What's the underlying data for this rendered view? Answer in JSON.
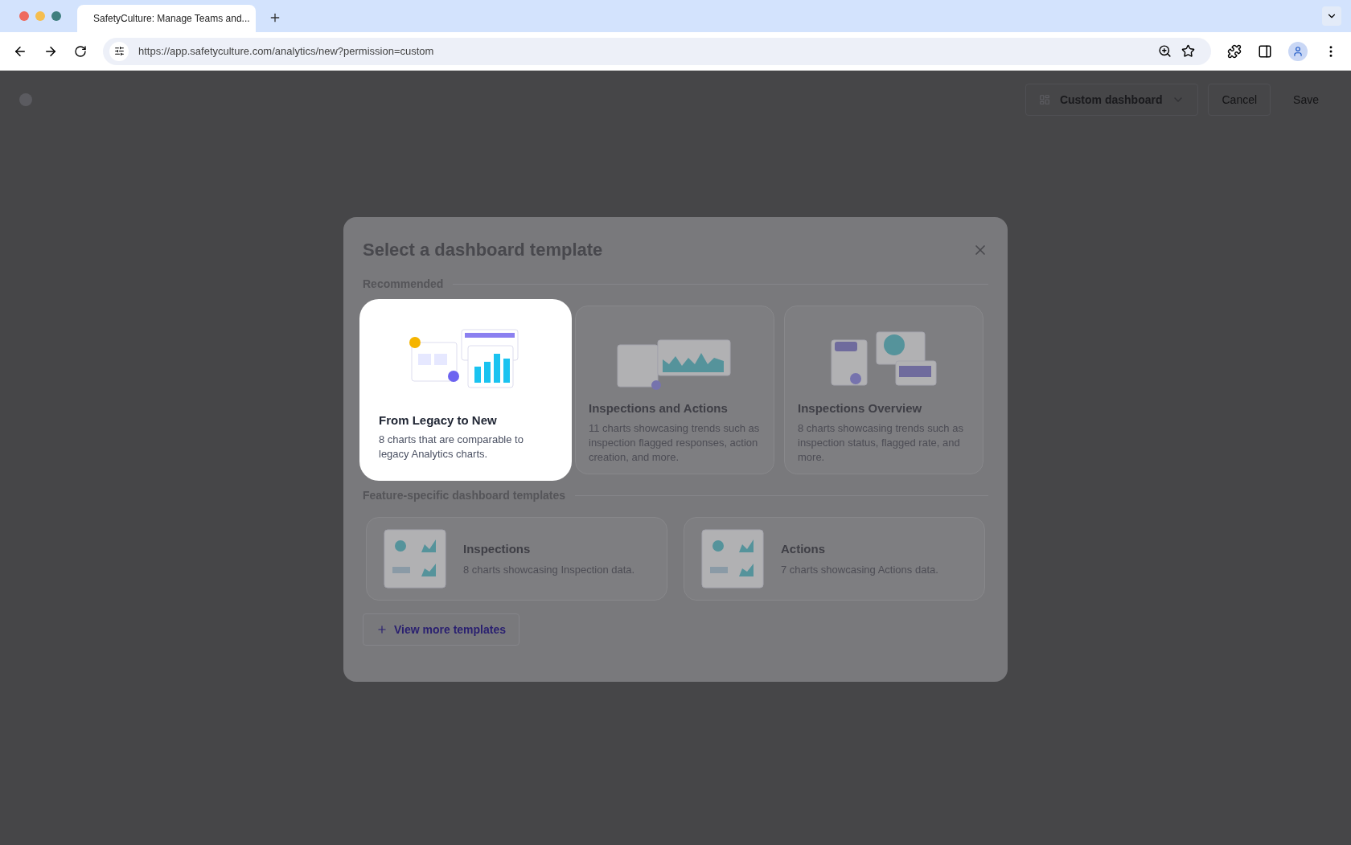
{
  "browser": {
    "tab_title": "SafetyCulture: Manage Teams and...",
    "url": "https://app.safetyculture.com/analytics/new?permission=custom"
  },
  "app_bar": {
    "dashboard_name": "Custom dashboard",
    "buttons": [
      "Cancel",
      "Save"
    ]
  },
  "modal": {
    "title": "Select a dashboard template",
    "sections": [
      {
        "heading": "Recommended",
        "kind": "recommended",
        "templates": [
          {
            "title": "From Legacy to New",
            "description": "8 charts that are comparable to legacy Analytics charts.",
            "selected": true
          },
          {
            "title": "Inspections and Actions",
            "description": "11 charts showcasing trends such as inspection flagged responses, action creation, and more.",
            "selected": false
          },
          {
            "title": "Inspections Overview",
            "description": "8 charts showcasing trends such as inspection status, flagged rate, and more.",
            "selected": false
          }
        ]
      },
      {
        "heading": "Feature-specific dashboard templates",
        "kind": "feature",
        "templates": [
          {
            "title": "Inspections",
            "description": "8 charts showcasing Inspection data.",
            "selected": false
          },
          {
            "title": "Actions",
            "description": "7 charts showcasing Actions data.",
            "selected": false
          }
        ]
      }
    ],
    "more_button": "View more templates"
  }
}
